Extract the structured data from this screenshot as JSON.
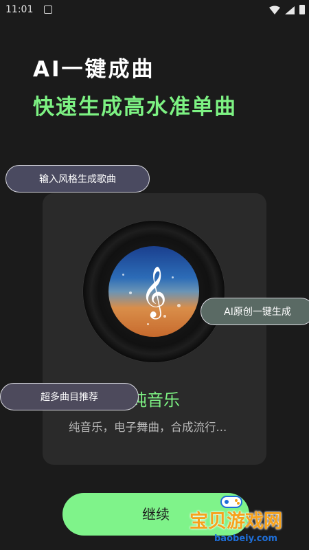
{
  "status_bar": {
    "time": "11:01"
  },
  "header": {
    "headline": "AI一键成曲",
    "subheadline": "快速生成高水准单曲"
  },
  "tags": {
    "input_style": "输入风格生成歌曲",
    "original": "AI原创一键生成",
    "more": "超多曲目推荐"
  },
  "card": {
    "title": "纯音乐",
    "description": "纯音乐，电子舞曲，合成流行..."
  },
  "actions": {
    "continue_label": "继续"
  },
  "watermark": {
    "brand": "宝贝游戏网",
    "url": "baobeiy.com"
  },
  "colors": {
    "background": "#1b1b1b",
    "accent_green": "#7df283",
    "card": "#2a2a2a"
  }
}
